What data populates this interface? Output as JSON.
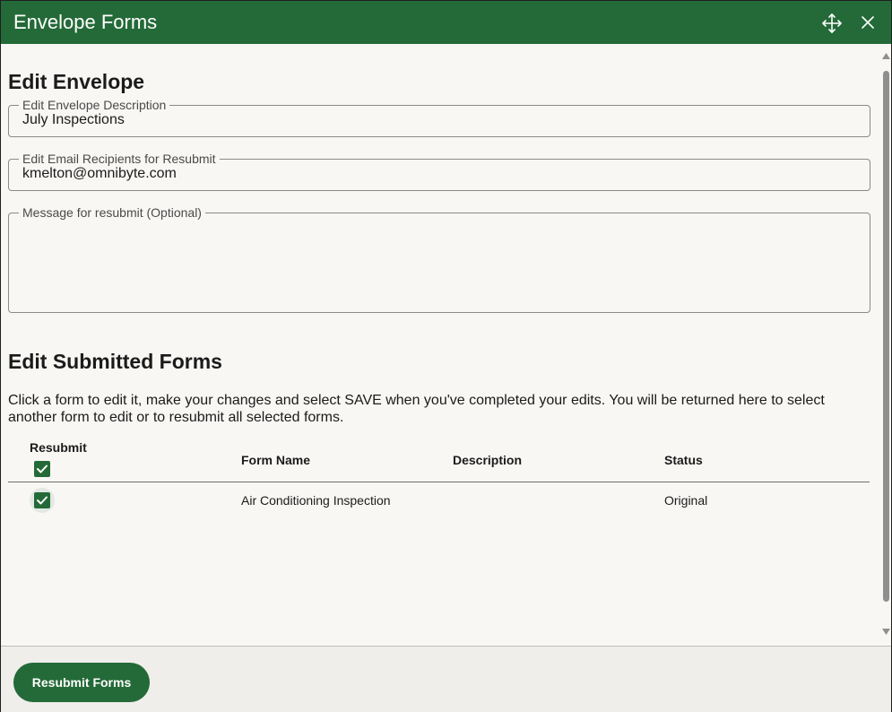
{
  "window": {
    "title": "Envelope Forms",
    "move_icon": "move-arrows-icon",
    "close_icon": "close-icon"
  },
  "sections": {
    "edit_envelope": "Edit Envelope",
    "edit_forms": "Edit Submitted Forms"
  },
  "fields": {
    "description": {
      "label": "Edit Envelope Description",
      "value": "July Inspections"
    },
    "recipients": {
      "label": "Edit Email Recipients for Resubmit",
      "value": "kmelton@omnibyte.com"
    },
    "message": {
      "label": "Message for resubmit (Optional)",
      "value": ""
    }
  },
  "instructions": "Click a form to edit it, make your changes and select SAVE when you've completed your edits. You will be returned here to select another form to edit or to resubmit all selected forms.",
  "table": {
    "headers": {
      "resubmit": "Resubmit",
      "form_name": "Form Name",
      "description": "Description",
      "status": "Status"
    },
    "select_all_checked": true,
    "rows": [
      {
        "checked": true,
        "form_name": "Air Conditioning Inspection",
        "description": "",
        "status": "Original"
      }
    ]
  },
  "footer": {
    "resubmit_label": "Resubmit Forms"
  },
  "colors": {
    "primary": "#246a38",
    "background": "#f8f7f4",
    "footer": "#efeeeb"
  }
}
